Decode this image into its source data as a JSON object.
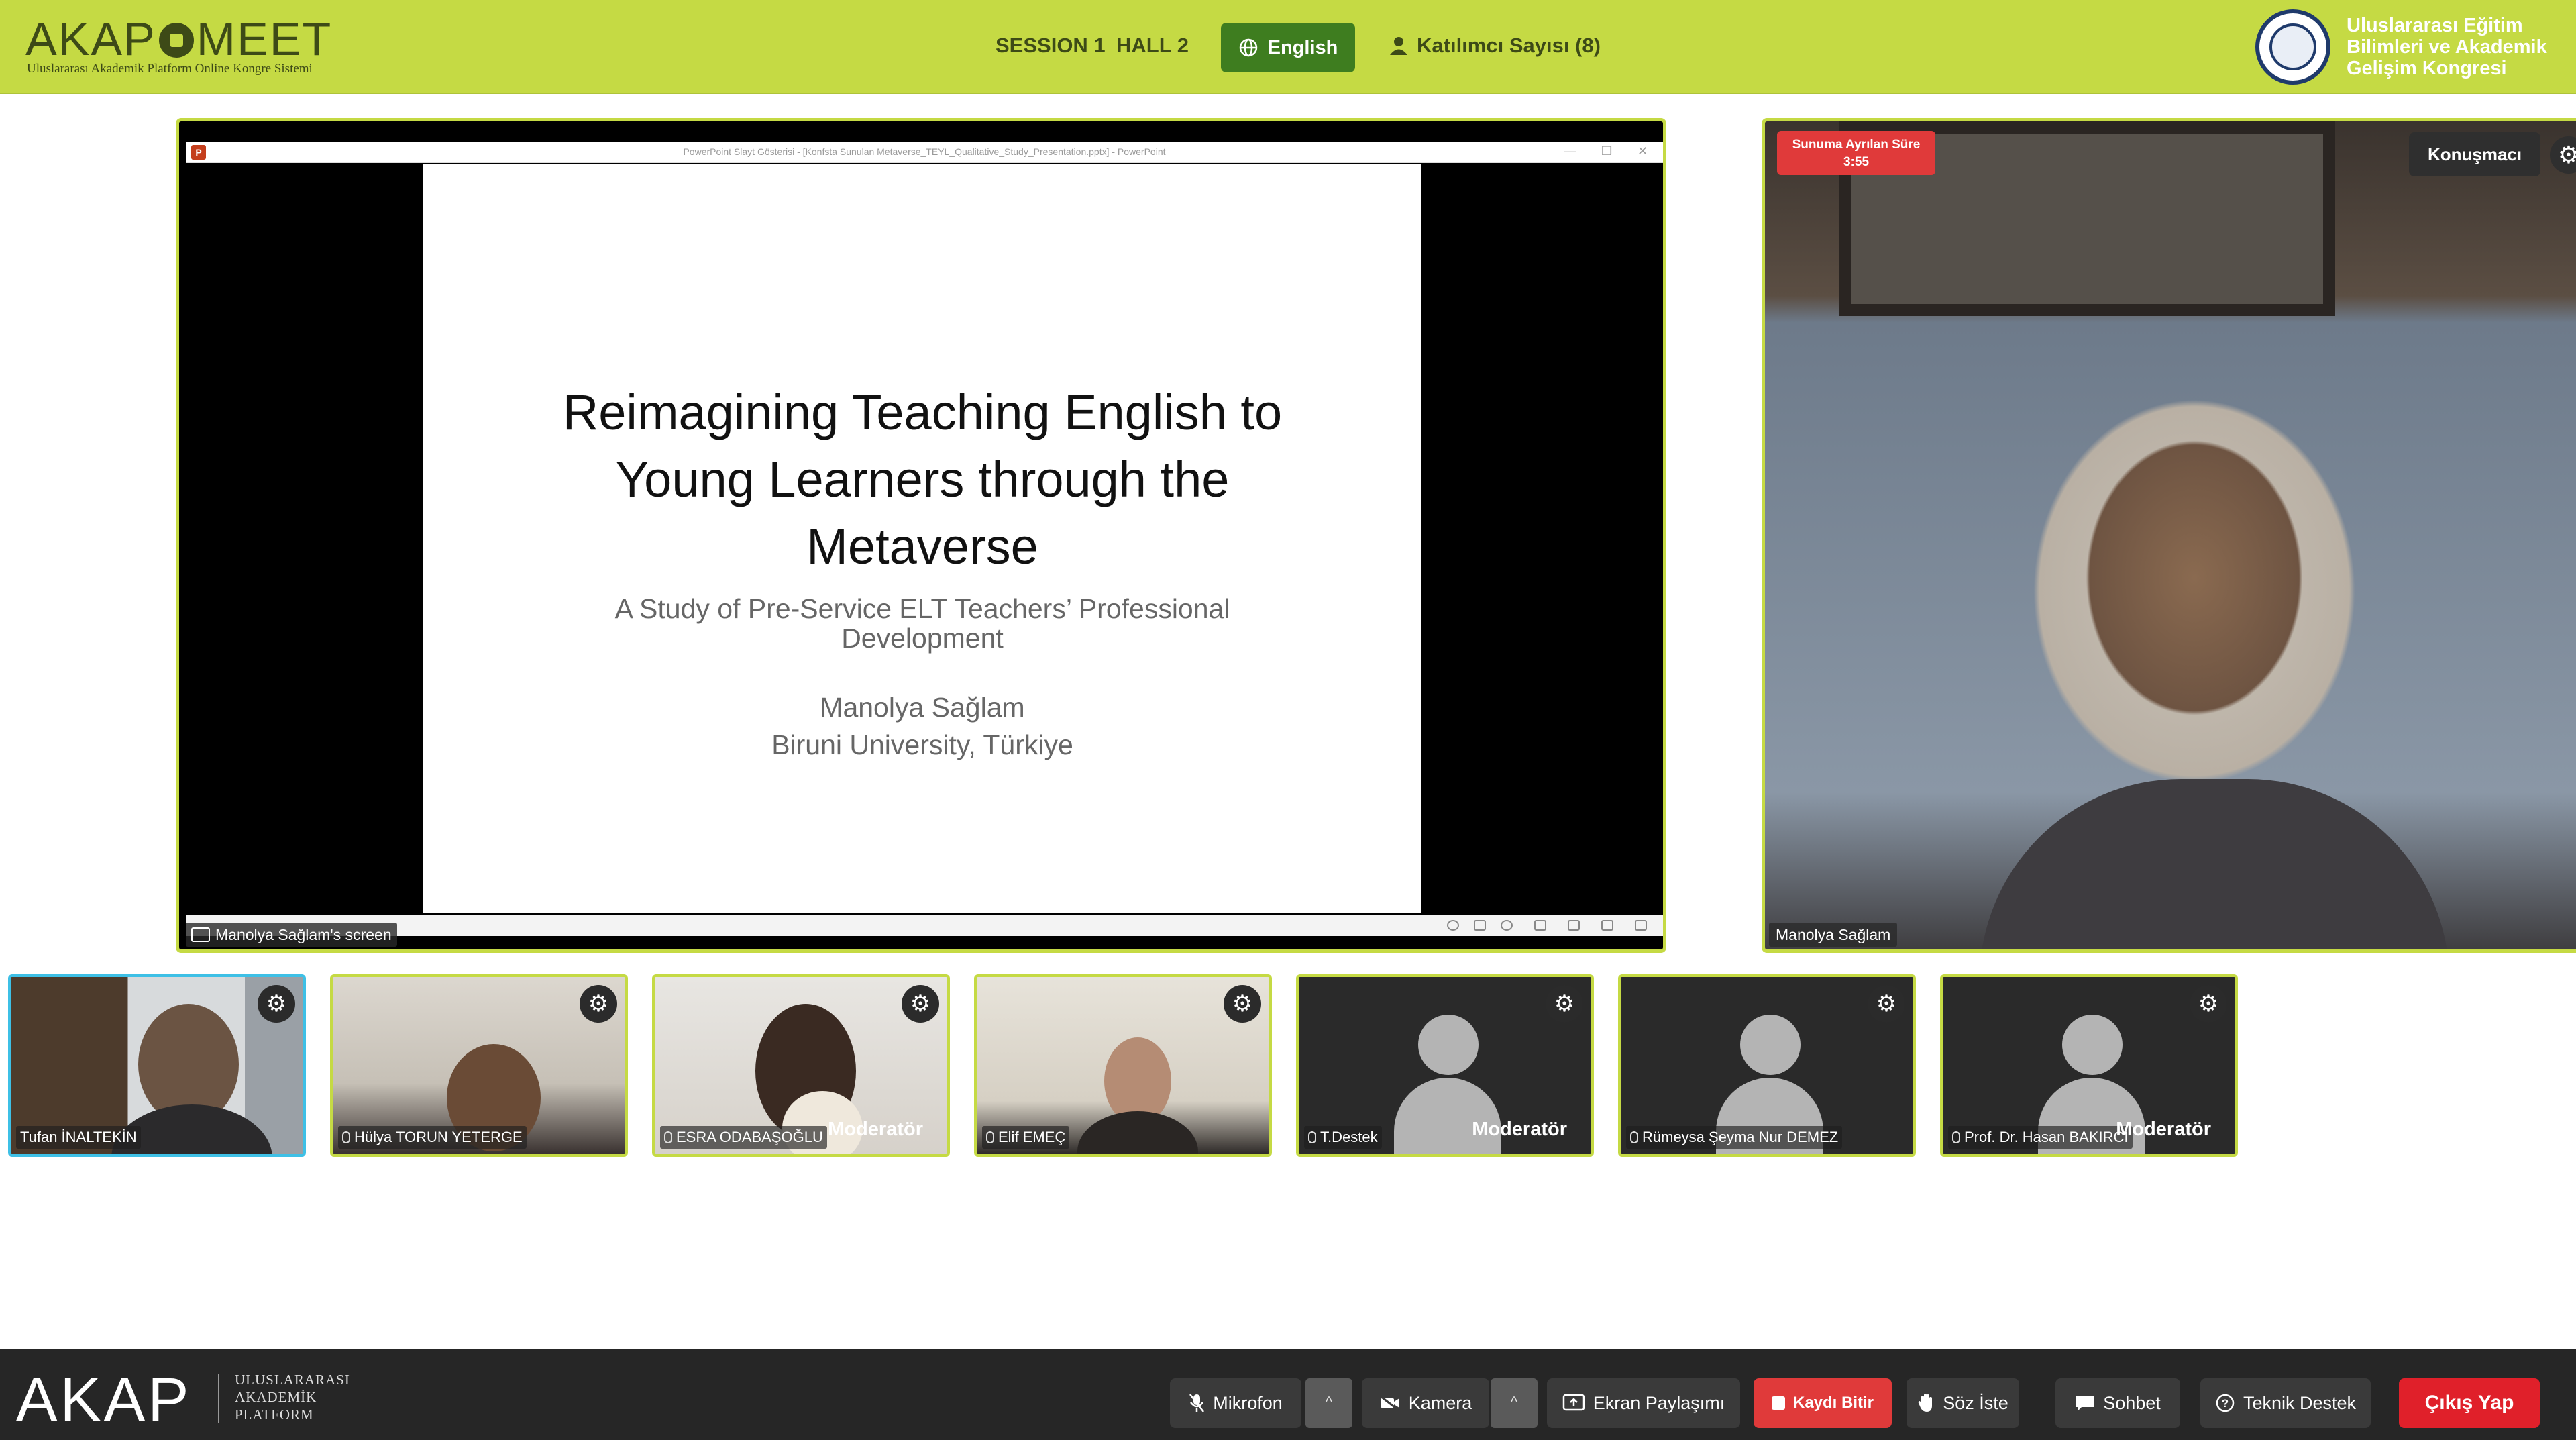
{
  "header": {
    "logo_left": "AKAP",
    "logo_right": "MEET",
    "logo_subtitle": "Uluslararası Akademik Platform Online Kongre Sistemi",
    "session": "SESSION 1",
    "hall": "HALL 2",
    "language_button": "English",
    "participant_count": "Katılımcı Sayısı (8)",
    "congress_lines": [
      "Uluslararası Eğitim",
      "Bilimleri ve Akademik",
      "Gelişim Kongresi"
    ]
  },
  "screen_share": {
    "window_title": "PowerPoint Slayt Gösterisi - [Konfsta Sunulan Metaverse_TEYL_Qualitative_Study_Presentation.pptx] - PowerPoint",
    "slide_title": "Reimagining Teaching English to Young Learners through the Metaverse",
    "slide_subtitle": "A Study of Pre-Service ELT Teachers’ Professional Development",
    "slide_author": "Manolya Sağlam",
    "slide_affiliation": "Biruni University, Türkiye",
    "share_label": "Manolya Sağlam's screen"
  },
  "speaker": {
    "timer_label": "Sunuma Ayrılan Süre",
    "timer_value": "3:55",
    "role_badge": "Konuşmacı",
    "name": "Manolya Sağlam"
  },
  "participants": [
    {
      "name": "Tufan İNALTEKİN",
      "role": "",
      "video": true,
      "active": true
    },
    {
      "name": "Hülya TORUN YETERGE",
      "role": "",
      "video": true,
      "active": false
    },
    {
      "name": "ESRA ODABAŞOĞLU",
      "role": "Moderatör",
      "video": true,
      "active": false
    },
    {
      "name": "Elif EMEÇ",
      "role": "",
      "video": true,
      "active": false
    },
    {
      "name": "T.Destek",
      "role": "Moderatör",
      "video": false,
      "active": false
    },
    {
      "name": "Rümeysa Şeyma Nur DEMEZ",
      "role": "",
      "video": false,
      "active": false
    },
    {
      "name": "Prof. Dr. Hasan BAKIRCI",
      "role": "Moderatör",
      "video": false,
      "active": false
    }
  ],
  "footer": {
    "logo": "AKAP",
    "logo_lines": [
      "ULUSLARARASI",
      "AKADEMİK",
      "PLATFORM"
    ],
    "microphone": "Mikrofon",
    "camera": "Kamera",
    "screen_share": "Ekran Paylaşımı",
    "record": "Kaydı Bitir",
    "raise_hand": "Söz İste",
    "chat": "Sohbet",
    "support": "Teknik Destek",
    "exit": "Çıkış Yap"
  },
  "icons": [
    "globe-icon",
    "user-icon",
    "gear-icon",
    "mic-off-icon",
    "camera-off-icon",
    "screen-share-icon",
    "stop-icon",
    "hand-icon",
    "chat-icon",
    "help-icon",
    "caret-up-icon"
  ],
  "colors": {
    "brand_green": "#c5da44",
    "dark_green": "#3e7d1f",
    "record_red": "#e03a3a",
    "exit_red": "#e0202a",
    "footer_bg": "#262626"
  }
}
